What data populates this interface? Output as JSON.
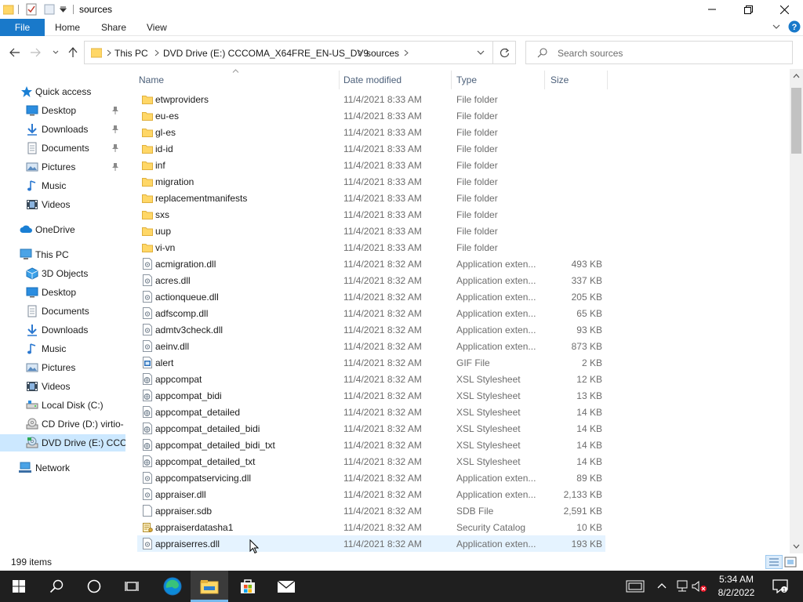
{
  "window": {
    "title": "sources"
  },
  "ribbon": {
    "file": "File",
    "tabs": [
      "Home",
      "Share",
      "View"
    ]
  },
  "address": {
    "crumbs": [
      "This PC",
      "DVD Drive (E:) CCCOMA_X64FRE_EN-US_DV9",
      "sources"
    ],
    "search_placeholder": "Search sources"
  },
  "nav": {
    "quick_access": "Quick access",
    "qa_items": [
      {
        "label": "Desktop",
        "icon": "desktop-icon"
      },
      {
        "label": "Downloads",
        "icon": "downloads-icon"
      },
      {
        "label": "Documents",
        "icon": "documents-icon"
      },
      {
        "label": "Pictures",
        "icon": "pictures-icon"
      },
      {
        "label": "Music",
        "icon": "music-icon"
      },
      {
        "label": "Videos",
        "icon": "videos-icon"
      }
    ],
    "onedrive": "OneDrive",
    "this_pc": "This PC",
    "pc_items": [
      {
        "label": "3D Objects",
        "icon": "3d-objects-icon"
      },
      {
        "label": "Desktop",
        "icon": "desktop-icon"
      },
      {
        "label": "Documents",
        "icon": "documents-icon"
      },
      {
        "label": "Downloads",
        "icon": "downloads-icon"
      },
      {
        "label": "Music",
        "icon": "music-icon"
      },
      {
        "label": "Pictures",
        "icon": "pictures-icon"
      },
      {
        "label": "Videos",
        "icon": "videos-icon"
      },
      {
        "label": "Local Disk (C:)",
        "icon": "local-disk-icon"
      },
      {
        "label": "CD Drive (D:) virtio-",
        "icon": "cd-drive-icon"
      },
      {
        "label": "DVD Drive (E:) CCCO",
        "icon": "dvd-drive-icon"
      }
    ],
    "network": "Network"
  },
  "columns": {
    "name": "Name",
    "date": "Date modified",
    "type": "Type",
    "size": "Size"
  },
  "files": [
    {
      "name": "etwproviders",
      "date": "11/4/2021 8:33 AM",
      "type": "File folder",
      "size": "",
      "icon": "folder"
    },
    {
      "name": "eu-es",
      "date": "11/4/2021 8:33 AM",
      "type": "File folder",
      "size": "",
      "icon": "folder"
    },
    {
      "name": "gl-es",
      "date": "11/4/2021 8:33 AM",
      "type": "File folder",
      "size": "",
      "icon": "folder"
    },
    {
      "name": "id-id",
      "date": "11/4/2021 8:33 AM",
      "type": "File folder",
      "size": "",
      "icon": "folder"
    },
    {
      "name": "inf",
      "date": "11/4/2021 8:33 AM",
      "type": "File folder",
      "size": "",
      "icon": "folder"
    },
    {
      "name": "migration",
      "date": "11/4/2021 8:33 AM",
      "type": "File folder",
      "size": "",
      "icon": "folder"
    },
    {
      "name": "replacementmanifests",
      "date": "11/4/2021 8:33 AM",
      "type": "File folder",
      "size": "",
      "icon": "folder"
    },
    {
      "name": "sxs",
      "date": "11/4/2021 8:33 AM",
      "type": "File folder",
      "size": "",
      "icon": "folder"
    },
    {
      "name": "uup",
      "date": "11/4/2021 8:33 AM",
      "type": "File folder",
      "size": "",
      "icon": "folder"
    },
    {
      "name": "vi-vn",
      "date": "11/4/2021 8:33 AM",
      "type": "File folder",
      "size": "",
      "icon": "folder"
    },
    {
      "name": "acmigration.dll",
      "date": "11/4/2021 8:32 AM",
      "type": "Application exten...",
      "size": "493 KB",
      "icon": "dll"
    },
    {
      "name": "acres.dll",
      "date": "11/4/2021 8:32 AM",
      "type": "Application exten...",
      "size": "337 KB",
      "icon": "dll"
    },
    {
      "name": "actionqueue.dll",
      "date": "11/4/2021 8:32 AM",
      "type": "Application exten...",
      "size": "205 KB",
      "icon": "dll"
    },
    {
      "name": "adfscomp.dll",
      "date": "11/4/2021 8:32 AM",
      "type": "Application exten...",
      "size": "65 KB",
      "icon": "dll"
    },
    {
      "name": "admtv3check.dll",
      "date": "11/4/2021 8:32 AM",
      "type": "Application exten...",
      "size": "93 KB",
      "icon": "dll"
    },
    {
      "name": "aeinv.dll",
      "date": "11/4/2021 8:32 AM",
      "type": "Application exten...",
      "size": "873 KB",
      "icon": "dll"
    },
    {
      "name": "alert",
      "date": "11/4/2021 8:32 AM",
      "type": "GIF File",
      "size": "2 KB",
      "icon": "gif"
    },
    {
      "name": "appcompat",
      "date": "11/4/2021 8:32 AM",
      "type": "XSL Stylesheet",
      "size": "12 KB",
      "icon": "xsl"
    },
    {
      "name": "appcompat_bidi",
      "date": "11/4/2021 8:32 AM",
      "type": "XSL Stylesheet",
      "size": "13 KB",
      "icon": "xsl"
    },
    {
      "name": "appcompat_detailed",
      "date": "11/4/2021 8:32 AM",
      "type": "XSL Stylesheet",
      "size": "14 KB",
      "icon": "xsl"
    },
    {
      "name": "appcompat_detailed_bidi",
      "date": "11/4/2021 8:32 AM",
      "type": "XSL Stylesheet",
      "size": "14 KB",
      "icon": "xsl"
    },
    {
      "name": "appcompat_detailed_bidi_txt",
      "date": "11/4/2021 8:32 AM",
      "type": "XSL Stylesheet",
      "size": "14 KB",
      "icon": "xsl"
    },
    {
      "name": "appcompat_detailed_txt",
      "date": "11/4/2021 8:32 AM",
      "type": "XSL Stylesheet",
      "size": "14 KB",
      "icon": "xsl"
    },
    {
      "name": "appcompatservicing.dll",
      "date": "11/4/2021 8:32 AM",
      "type": "Application exten...",
      "size": "89 KB",
      "icon": "dll"
    },
    {
      "name": "appraiser.dll",
      "date": "11/4/2021 8:32 AM",
      "type": "Application exten...",
      "size": "2,133 KB",
      "icon": "dll"
    },
    {
      "name": "appraiser.sdb",
      "date": "11/4/2021 8:32 AM",
      "type": "SDB File",
      "size": "2,591 KB",
      "icon": "sdb"
    },
    {
      "name": "appraiserdatasha1",
      "date": "11/4/2021 8:32 AM",
      "type": "Security Catalog",
      "size": "10 KB",
      "icon": "cat"
    },
    {
      "name": "appraiserres.dll",
      "date": "11/4/2021 8:32 AM",
      "type": "Application exten...",
      "size": "193 KB",
      "icon": "dll"
    }
  ],
  "status": {
    "count": "199 items"
  },
  "taskbar": {
    "time": "5:34 AM",
    "date": "8/2/2022"
  },
  "colors": {
    "accent": "#1979ca",
    "selected": "#cce8ff",
    "hover": "#e5f3ff",
    "folder": "#ffd767",
    "taskbar": "#1f1f1f"
  }
}
